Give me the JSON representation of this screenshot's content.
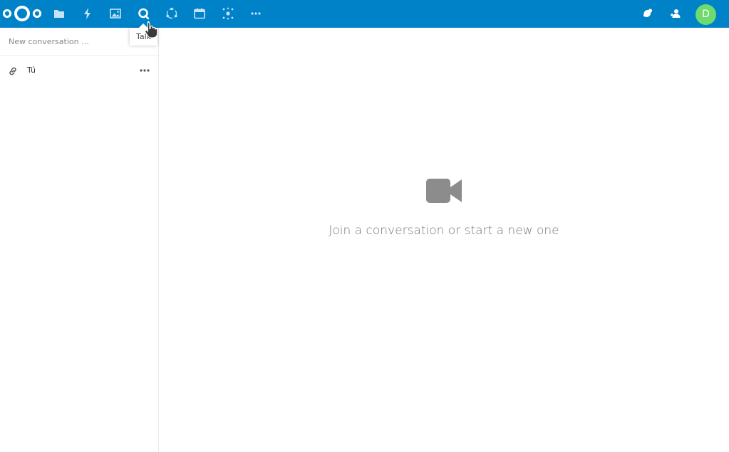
{
  "header": {
    "brand_color": "#0082c9",
    "logo_icon": "nextcloud-logo-icon",
    "apps": [
      {
        "name": "files-icon",
        "label": "Files"
      },
      {
        "name": "activity-icon",
        "label": "Activity"
      },
      {
        "name": "gallery-icon",
        "label": "Gallery"
      },
      {
        "name": "talk-icon",
        "label": "Talk",
        "active": true
      },
      {
        "name": "circles-icon",
        "label": "Circles"
      },
      {
        "name": "calendar-icon",
        "label": "Calendar"
      },
      {
        "name": "social-icon",
        "label": "Social"
      },
      {
        "name": "more-apps-icon",
        "label": "More"
      }
    ],
    "right_icons": [
      "notifications-icon",
      "contacts-icon"
    ],
    "user_initial": "D",
    "avatar_color": "#6edb6e"
  },
  "tooltip": {
    "text": "Talk"
  },
  "sidebar": {
    "search_placeholder": "New conversation …",
    "conversations": [
      {
        "icon": "link-icon",
        "name": "Tú"
      }
    ]
  },
  "main": {
    "empty_icon": "video-camera-icon",
    "empty_message": "Join a conversation or start a new one"
  }
}
